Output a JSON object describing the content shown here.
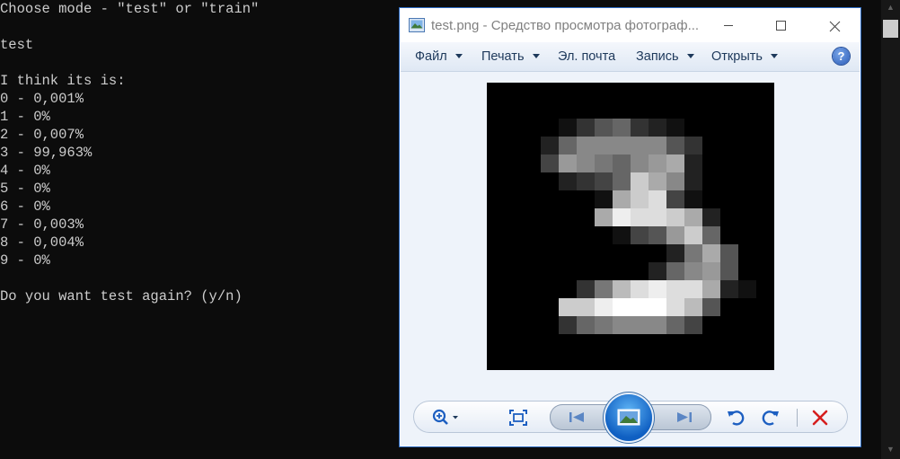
{
  "console": {
    "lines": [
      "Choose mode - \"test\" or \"train\"",
      "",
      "test",
      "",
      "I think its is:",
      "0 - 0,001%",
      "1 - 0%",
      "2 - 0,007%",
      "3 - 99,963%",
      "4 - 0%",
      "5 - 0%",
      "6 - 0%",
      "7 - 0,003%",
      "8 - 0,004%",
      "9 - 0%",
      "",
      "Do you want test again? (y/n)"
    ]
  },
  "viewer": {
    "title": "test.png - Средство просмотра фотограф...",
    "menu": {
      "file": "Файл",
      "print": "Печать",
      "email": "Эл. почта",
      "burn": "Запись",
      "open": "Открыть"
    },
    "help_glyph": "?",
    "icons": [
      "app-icon",
      "minimize-icon",
      "maximize-icon",
      "close-icon",
      "help-icon",
      "zoom-icon",
      "actual-size-icon",
      "previous-icon",
      "slideshow-icon",
      "next-icon",
      "rotate-left-icon",
      "rotate-right-icon",
      "delete-icon"
    ],
    "colors": {
      "delete": "#d61e1e",
      "rotate": "#1d5fc1",
      "menu_text": "#1e395b",
      "console_bg": "#0c0c0c",
      "console_text": "#cccccc"
    }
  },
  "image_pixels": {
    "grid_size": 16,
    "rows": [
      "0000000000000000",
      "0000000000000000",
      "000013563210000",
      "0002688888530000",
      "0004987689A20000",
      "00002346CA820000",
      "0000001ACD410000",
      "000000AEDDCA2000",
      "00000001459C6000",
      "000000000027A500",
      "0000000002689500",
      "0000037BDEDDA210",
      "0000CCEFFFDB5000",
      "00003678886400000",
      "0000000000000000",
      "0000000000000000"
    ]
  }
}
